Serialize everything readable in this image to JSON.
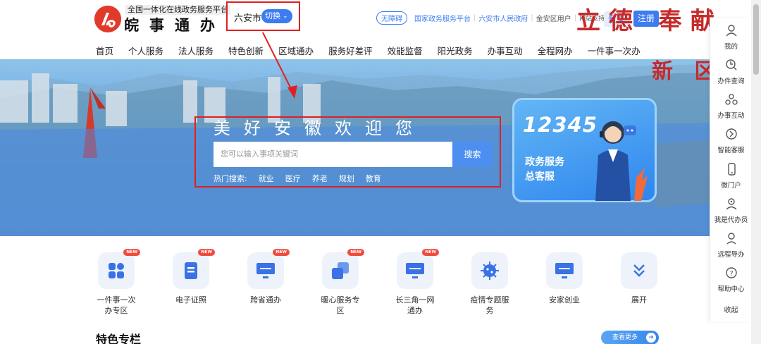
{
  "header": {
    "brand_sub": "全国一体化在线政务服务平台",
    "brand_title": "皖事通办",
    "city": "六安市",
    "switch_label": "切换",
    "accessibility": "无障碍",
    "links": [
      "国家政务服务平台",
      "六安市人民政府"
    ],
    "district": "金安区用户",
    "ipv6": "网站支持IPv6",
    "login": "登录",
    "register": "注册"
  },
  "nav": [
    "首页",
    "个人服务",
    "法人服务",
    "特色创新",
    "区域通办",
    "服务好差评",
    "效能监督",
    "阳光政务",
    "办事互动",
    "全程网办",
    "一件事一次办"
  ],
  "banner": {
    "welcome": "美好安徽欢迎您",
    "search_placeholder": "您可以输入事项关键词",
    "search_button": "搜索",
    "hot_label": "热门搜索:",
    "hot_terms": [
      "就业",
      "医疗",
      "养老",
      "规划",
      "教育"
    ],
    "deco_text_1": "立德 奉献",
    "deco_text_2": "新 区",
    "hotline_number": "12345",
    "hotline_line1": "政务服务",
    "hotline_line2": "总客服"
  },
  "services": [
    {
      "label": "一件事一次办专区",
      "new": "NEW",
      "icon": "grid-icon"
    },
    {
      "label": "电子证照",
      "new": "NEW",
      "icon": "document-icon"
    },
    {
      "label": "跨省通办",
      "new": "NEW",
      "icon": "monitor-icon"
    },
    {
      "label": "暖心服务专区",
      "new": "NEW",
      "icon": "layers-icon"
    },
    {
      "label": "长三角一网通办",
      "new": "NEW",
      "icon": "monitor-icon"
    },
    {
      "label": "疫情专题服务",
      "new": "",
      "icon": "virus-icon"
    },
    {
      "label": "安家创业",
      "new": "",
      "icon": "monitor-icon"
    },
    {
      "label": "展开",
      "new": "",
      "icon": "double-chevron-down-icon"
    }
  ],
  "section": {
    "title": "特色专栏",
    "more": "查看更多"
  },
  "sidebar": [
    {
      "label": "我的",
      "icon": "user-icon"
    },
    {
      "label": "办件查询",
      "icon": "clock-search-icon"
    },
    {
      "label": "办事互动",
      "icon": "chat-icon"
    },
    {
      "label": "智能客服",
      "icon": "robot-icon"
    },
    {
      "label": "微门户",
      "icon": "phone-icon"
    },
    {
      "label": "我是代办员",
      "icon": "agent-icon"
    },
    {
      "label": "远程导办",
      "icon": "guide-icon"
    },
    {
      "label": "帮助中心",
      "icon": "help-icon"
    }
  ],
  "sidebar_collapse": "收起",
  "colors": {
    "accent": "#3d7cf0",
    "annotation": "#e02020",
    "logo": "#e23a2a"
  }
}
